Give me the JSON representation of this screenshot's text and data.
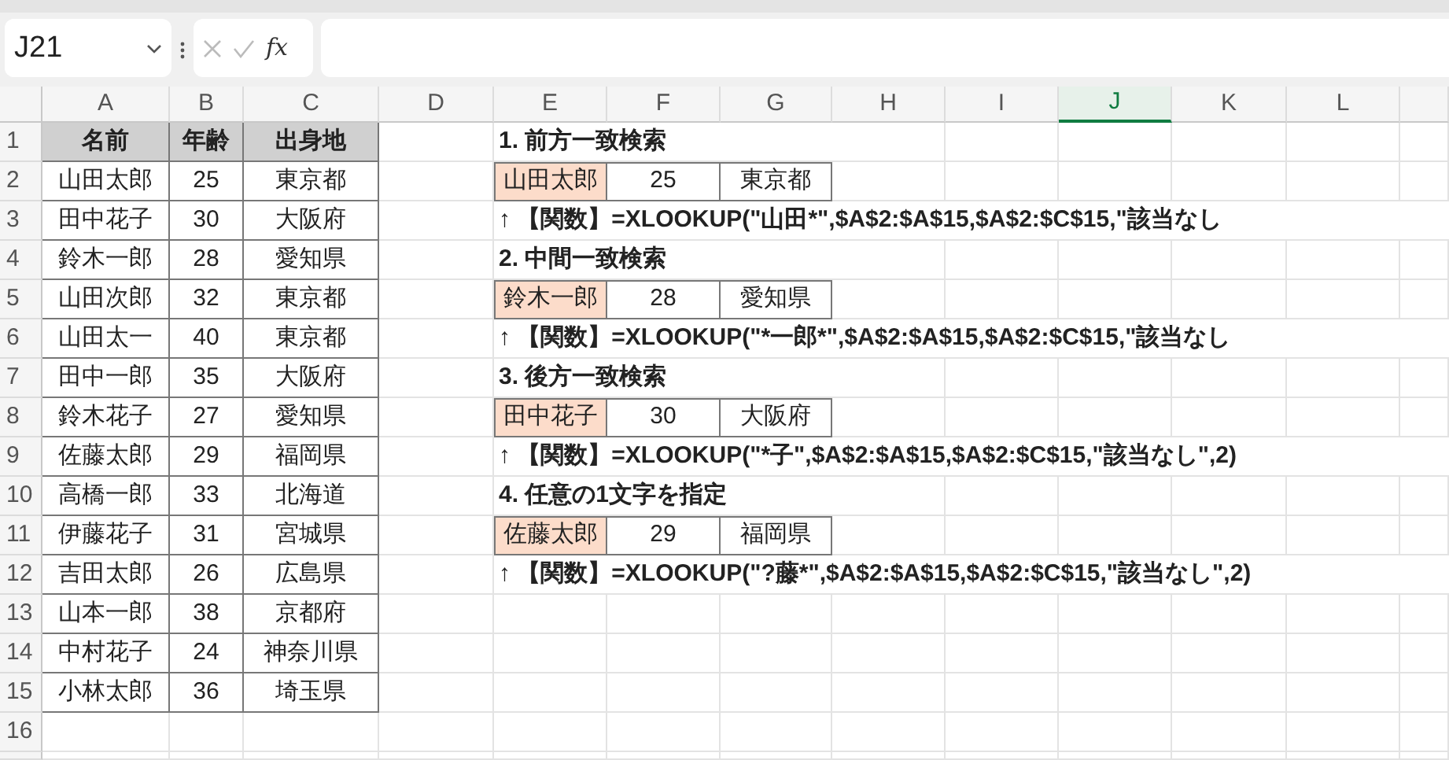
{
  "name_box": {
    "value": "J21"
  },
  "formula_bar": {
    "function_label": "fx"
  },
  "columns": [
    {
      "label": "A",
      "selected": false
    },
    {
      "label": "B",
      "selected": false
    },
    {
      "label": "C",
      "selected": false
    },
    {
      "label": "D",
      "selected": false
    },
    {
      "label": "E",
      "selected": false
    },
    {
      "label": "F",
      "selected": false
    },
    {
      "label": "G",
      "selected": false
    },
    {
      "label": "H",
      "selected": false
    },
    {
      "label": "I",
      "selected": false
    },
    {
      "label": "J",
      "selected": true
    },
    {
      "label": "K",
      "selected": false
    },
    {
      "label": "L",
      "selected": false
    }
  ],
  "row_numbers": [
    "1",
    "2",
    "3",
    "4",
    "5",
    "6",
    "7",
    "8",
    "9",
    "10",
    "11",
    "12",
    "13",
    "14",
    "15",
    "16"
  ],
  "table": {
    "columns": [
      "名前",
      "年齢",
      "出身地"
    ],
    "rows": [
      [
        "山田太郎",
        "25",
        "東京都"
      ],
      [
        "田中花子",
        "30",
        "大阪府"
      ],
      [
        "鈴木一郎",
        "28",
        "愛知県"
      ],
      [
        "山田次郎",
        "32",
        "東京都"
      ],
      [
        "山田太一",
        "40",
        "東京都"
      ],
      [
        "田中一郎",
        "35",
        "大阪府"
      ],
      [
        "鈴木花子",
        "27",
        "愛知県"
      ],
      [
        "佐藤太郎",
        "29",
        "福岡県"
      ],
      [
        "高橋一郎",
        "33",
        "北海道"
      ],
      [
        "伊藤花子",
        "31",
        "宮城県"
      ],
      [
        "吉田太郎",
        "26",
        "広島県"
      ],
      [
        "山本一郎",
        "38",
        "京都府"
      ],
      [
        "中村花子",
        "24",
        "神奈川県"
      ],
      [
        "小林太郎",
        "36",
        "埼玉県"
      ]
    ]
  },
  "sections": [
    {
      "title": "1. 前方一致検索",
      "result": [
        "山田太郎",
        "25",
        "東京都"
      ],
      "formula": "↑ 【関数】=XLOOKUP(\"山田*\",$A$2:$A$15,$A$2:$C$15,\"該当なし"
    },
    {
      "title": "2. 中間一致検索",
      "result": [
        "鈴木一郎",
        "28",
        "愛知県"
      ],
      "formula": "↑ 【関数】=XLOOKUP(\"*一郎*\",$A$2:$A$15,$A$2:$C$15,\"該当なし"
    },
    {
      "title": "3. 後方一致検索",
      "result": [
        "田中花子",
        "30",
        "大阪府"
      ],
      "formula": "↑ 【関数】=XLOOKUP(\"*子\",$A$2:$A$15,$A$2:$C$15,\"該当なし\",2)"
    },
    {
      "title": "4. 任意の1文字を指定",
      "result": [
        "佐藤太郎",
        "29",
        "福岡県"
      ],
      "formula": "↑ 【関数】=XLOOKUP(\"?藤*\",$A$2:$A$15,$A$2:$C$15,\"該当なし\",2)"
    }
  ]
}
